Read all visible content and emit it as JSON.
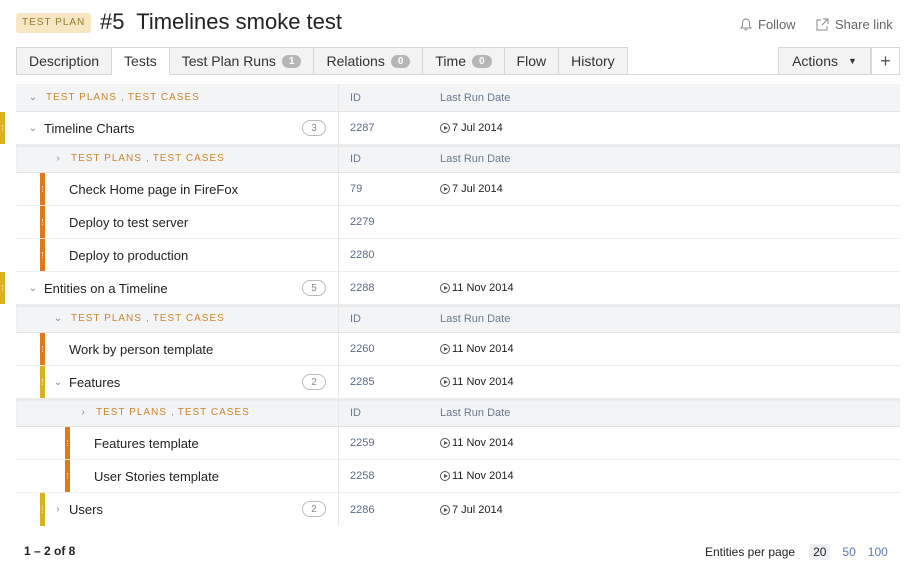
{
  "header": {
    "type_badge": "TEST PLAN",
    "number": "#5",
    "title": "Timelines smoke test",
    "follow": "Follow",
    "share": "Share link"
  },
  "tabs": [
    {
      "label": "Description",
      "count": null
    },
    {
      "label": "Tests",
      "count": null
    },
    {
      "label": "Test Plan Runs",
      "count": "1"
    },
    {
      "label": "Relations",
      "count": "0"
    },
    {
      "label": "Time",
      "count": "0"
    },
    {
      "label": "Flow",
      "count": null
    },
    {
      "label": "History",
      "count": null
    }
  ],
  "actions": {
    "label": "Actions",
    "plus": "+"
  },
  "columns": {
    "id": "ID",
    "last_run": "Last Run Date"
  },
  "groupTags": {
    "plans": "TEST PLANS",
    "cases": "TEST CASES",
    "sep": ","
  },
  "rows": {
    "r1": {
      "name": "Timeline Charts",
      "count": "3",
      "id": "2287",
      "date": "7 Jul 2014"
    },
    "r2": {
      "name": "Check Home page in FireFox",
      "id": "79",
      "date": "7 Jul 2014"
    },
    "r3": {
      "name": "Deploy to test server",
      "id": "2279",
      "date": ""
    },
    "r4": {
      "name": "Deploy to production",
      "id": "2280",
      "date": ""
    },
    "r5": {
      "name": "Entities on a Timeline",
      "count": "5",
      "id": "2288",
      "date": "11 Nov 2014"
    },
    "r6": {
      "name": "Work by person template",
      "id": "2260",
      "date": "11 Nov 2014"
    },
    "r7": {
      "name": "Features",
      "count": "2",
      "id": "2285",
      "date": "11 Nov 2014"
    },
    "r8": {
      "name": "Features template",
      "id": "2259",
      "date": "11 Nov 2014"
    },
    "r9": {
      "name": "User Stories template",
      "id": "2258",
      "date": "11 Nov 2014"
    },
    "r10": {
      "name": "Users",
      "count": "2",
      "id": "2286",
      "date": "7 Jul 2014"
    }
  },
  "footer": {
    "range": "1 – 2 of 8",
    "per_page_label": "Entities per page",
    "options": [
      "20",
      "50",
      "100"
    ]
  },
  "colors": {
    "plan_bar": "#d9b21f",
    "case_bar": "#df7a1a",
    "tag": "#c9852a",
    "id_link": "#5a6a8a"
  }
}
